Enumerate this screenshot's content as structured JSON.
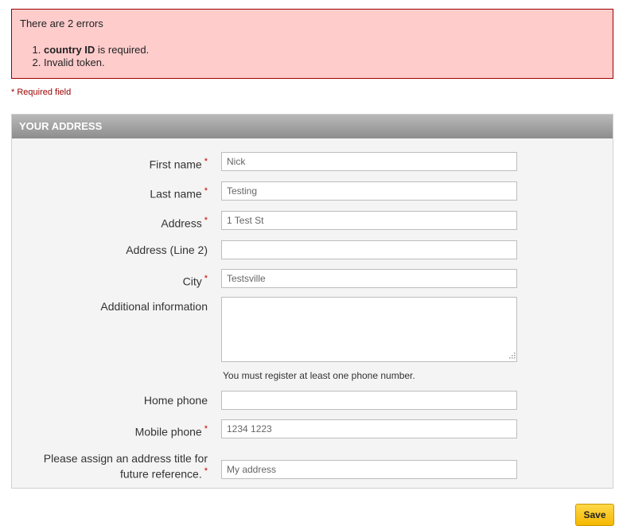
{
  "errors": {
    "title": "There are 2 errors",
    "items": [
      {
        "bold": "country ID",
        "rest": " is required."
      },
      {
        "bold": "",
        "rest": "Invalid token."
      }
    ]
  },
  "required_note": "* Required field",
  "panel": {
    "title": "Your address"
  },
  "fields": {
    "first_name": {
      "label": "First name",
      "value": "Nick"
    },
    "last_name": {
      "label": "Last name",
      "value": "Testing"
    },
    "address": {
      "label": "Address",
      "value": "1 Test St"
    },
    "address2": {
      "label": "Address (Line 2)",
      "value": ""
    },
    "city": {
      "label": "City",
      "value": "Testsville"
    },
    "other": {
      "label": "Additional information",
      "value": ""
    },
    "phone_hint": "You must register at least one phone number.",
    "home_phone": {
      "label": "Home phone",
      "value": ""
    },
    "mobile_phone": {
      "label": "Mobile phone",
      "value": "1234 1223"
    },
    "alias": {
      "label_line1": "Please assign an address title for",
      "label_line2": "future reference.",
      "value": "My address"
    }
  },
  "required_star": "*",
  "buttons": {
    "save": "Save"
  },
  "colors": {
    "error_bg": "#ffcccc",
    "error_border": "#990000",
    "required": "#cc0000",
    "save_button": "#f5b800"
  }
}
